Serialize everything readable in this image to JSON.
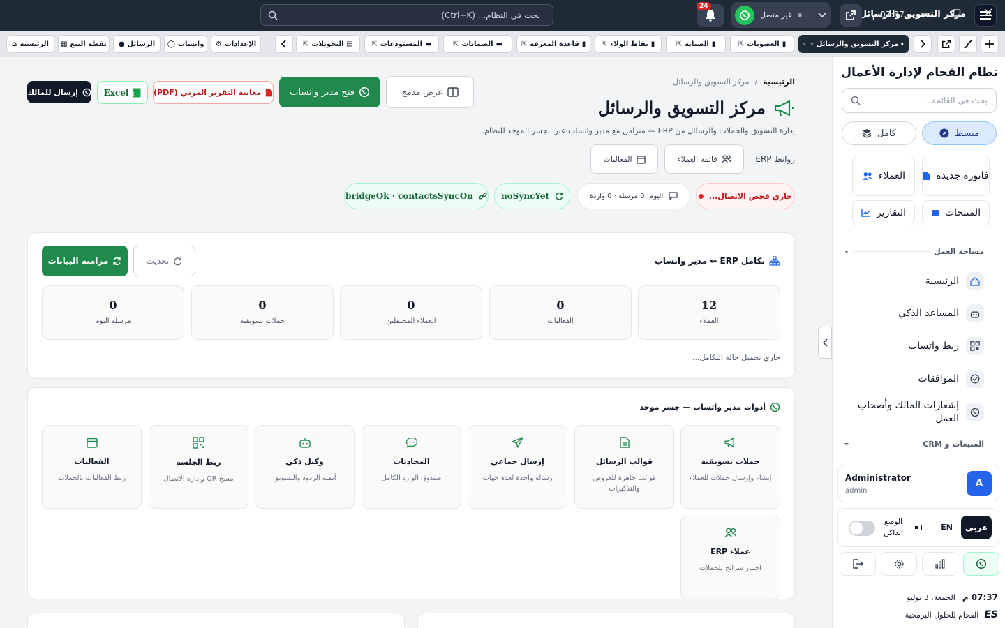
{
  "titlebar": {
    "title": "مركز التسويق والرسائل",
    "search_placeholder": "بحث في النظام... (Ctrl+K)",
    "notif_count": "24",
    "wa_status": "غير متصل",
    "clock": "07:37 م"
  },
  "tabs": {
    "active": "مركز التسويق والرسائل",
    "items": [
      "العضويات",
      "الصيانة",
      "نقاط الولاء",
      "قاعدة المعرفة",
      "الضمانات",
      "المستودعات",
      "التحويلات"
    ],
    "right_items": [
      "الإعدادات",
      "واتساب",
      "الرسائل",
      "نقطة البيع",
      "الرئيسية"
    ]
  },
  "header": {
    "breadcrumb_home": "الرئيسية",
    "breadcrumb_sep": "/",
    "breadcrumb_current": "مركز التسويق والرسائل",
    "title": "مركز التسويق والرسائل",
    "subtitle": "إدارة التسويق والحملات والرسائل من ERP — متزامن مع مدير واتساب عبر الجسر الموحد للنظام.",
    "links_label": "روابط ERP",
    "link_customers": "قائمة العملاء",
    "link_events": "الفعاليات"
  },
  "actions": {
    "embedded": "عرض مدمج",
    "open_wa": "فتح مدير واتساب",
    "pdf": "معاينة التقرير المرني (PDF)",
    "excel": "Excel",
    "send_owner": "إرسال للمالك"
  },
  "status": {
    "checking": "جاري فحص الاتصال...",
    "today": "اليوم: 0 مرسلة · 0 واردة",
    "sync": "noSyncYet",
    "bridge": "bridgeOk · contactsSyncOn"
  },
  "integration": {
    "title": "تكامل ERP ↔ مدير واتساب",
    "refresh": "تحديث",
    "sync": "مزامنة البيانات",
    "stats": [
      {
        "value": "12",
        "label": "العملاء"
      },
      {
        "value": "0",
        "label": "الفعاليات"
      },
      {
        "value": "0",
        "label": "العملاء المحتملين"
      },
      {
        "value": "0",
        "label": "حملات تسويقية"
      },
      {
        "value": "0",
        "label": "مرسلة اليوم"
      }
    ],
    "loading": "جاري تحميل حالة التكامل..."
  },
  "tools": {
    "title": "أدوات مدير واتساب — جسر موحد",
    "items": [
      {
        "icon": "megaphone-icon",
        "title": "حملات تسويقية",
        "desc": "إنشاء وإرسال حملات للعملاء"
      },
      {
        "icon": "document-icon",
        "title": "قوالب الرسائل",
        "desc": "قوالب جاهزة للعروض والتذكيرات"
      },
      {
        "icon": "send-icon",
        "title": "إرسال جماعي",
        "desc": "رسالة واحدة لعدة جهات"
      },
      {
        "icon": "chat-icon",
        "title": "المحادثات",
        "desc": "صندوق الوارد الكامل"
      },
      {
        "icon": "bot-icon",
        "title": "وكيل ذكي",
        "desc": "أتمتة الردود والتسويق"
      },
      {
        "icon": "qr-icon",
        "title": "ربط الجلسة",
        "desc": "مسح QR وإدارة الاتصال"
      },
      {
        "icon": "calendar-icon",
        "title": "الفعاليات",
        "desc": "ربط الفعاليات بالحملات"
      },
      {
        "icon": "users-icon",
        "title": "عملاء ERP",
        "desc": "اختيار شرائح للحملات"
      }
    ]
  },
  "sidebar": {
    "title": "نظام الفحام لإدارة الأعمال",
    "search_placeholder": "بحث في القائمة...",
    "mode_compact": "مبسط",
    "mode_full": "كامل",
    "quick": {
      "invoice": "فاتورة جديدة",
      "customers": "العملاء",
      "products": "المنتجات",
      "reports": "التقارير"
    },
    "section_workspace": "مساحة العمل",
    "nav": [
      "الرئيسية",
      "المساعد الذكي",
      "ربط واتساب",
      "الموافقات",
      "إشعارات المالك وأصحاب العمل"
    ],
    "section_sales": "المبيعات و CRM",
    "user_name": "Administrator",
    "user_role": "admin",
    "avatar": "A",
    "lang_ar": "عربي",
    "lang_en": "EN",
    "dark_mode": "الوضع الداكن",
    "time": "07:37 م",
    "date": "الجمعة، 3 يوليو",
    "company": "الفحام للحلول البرمجية",
    "company_logo": "ES"
  },
  "colors": {
    "accent_green": "#1f8a4c",
    "dark": "#1f2a37",
    "danger": "#dc2626",
    "blue": "#2563eb"
  }
}
